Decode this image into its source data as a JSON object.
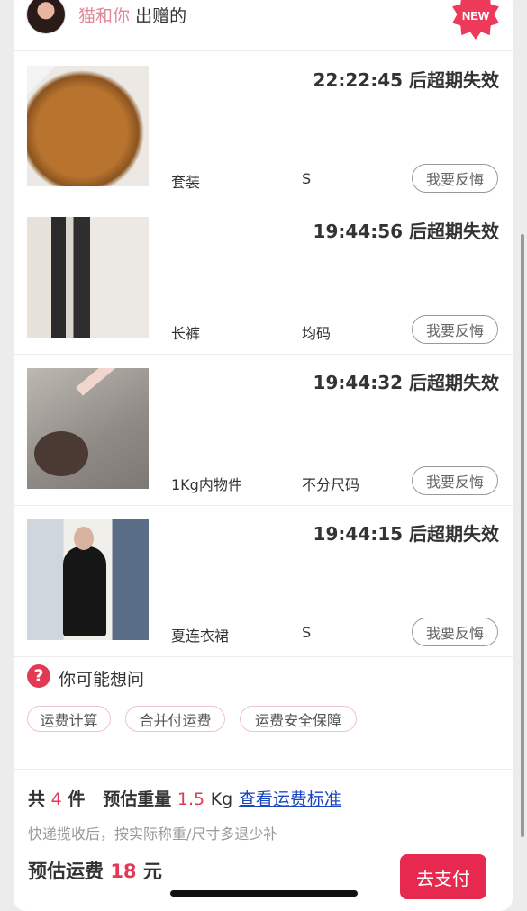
{
  "header": {
    "gifter_name": "猫和你",
    "gifter_suffix": "出赠的",
    "badge": "NEW"
  },
  "items": [
    {
      "timer": "22:22:45 后超期失效",
      "category": "套装",
      "size": "S",
      "action": "我要反悔"
    },
    {
      "timer": "19:44:56 后超期失效",
      "category": "长裤",
      "size": "均码",
      "action": "我要反悔"
    },
    {
      "timer": "19:44:32 后超期失效",
      "category": "1Kg内物件",
      "size": "不分尺码",
      "action": "我要反悔"
    },
    {
      "timer": "19:44:15 后超期失效",
      "category": "夏连衣裙",
      "size": "S",
      "action": "我要反悔"
    }
  ],
  "faq": {
    "icon": "?",
    "title": "你可能想问",
    "chips": [
      "运费计算",
      "合并付运费",
      "运费安全保障"
    ]
  },
  "summary": {
    "count_prefix": "共",
    "count": "4",
    "count_suffix": "件",
    "weight_label": "预估重量",
    "weight_value": "1.5",
    "weight_unit": "Kg",
    "link": "查看运费标准",
    "note": "快递揽收后，按实际称重/尺寸多退少补",
    "fee_label": "预估运费",
    "fee_value": "18",
    "fee_unit": "元",
    "pay_button": "去支付"
  },
  "colors": {
    "accent": "#e8294f",
    "link": "#1a45c2",
    "gifter_name": "#e2889a"
  }
}
